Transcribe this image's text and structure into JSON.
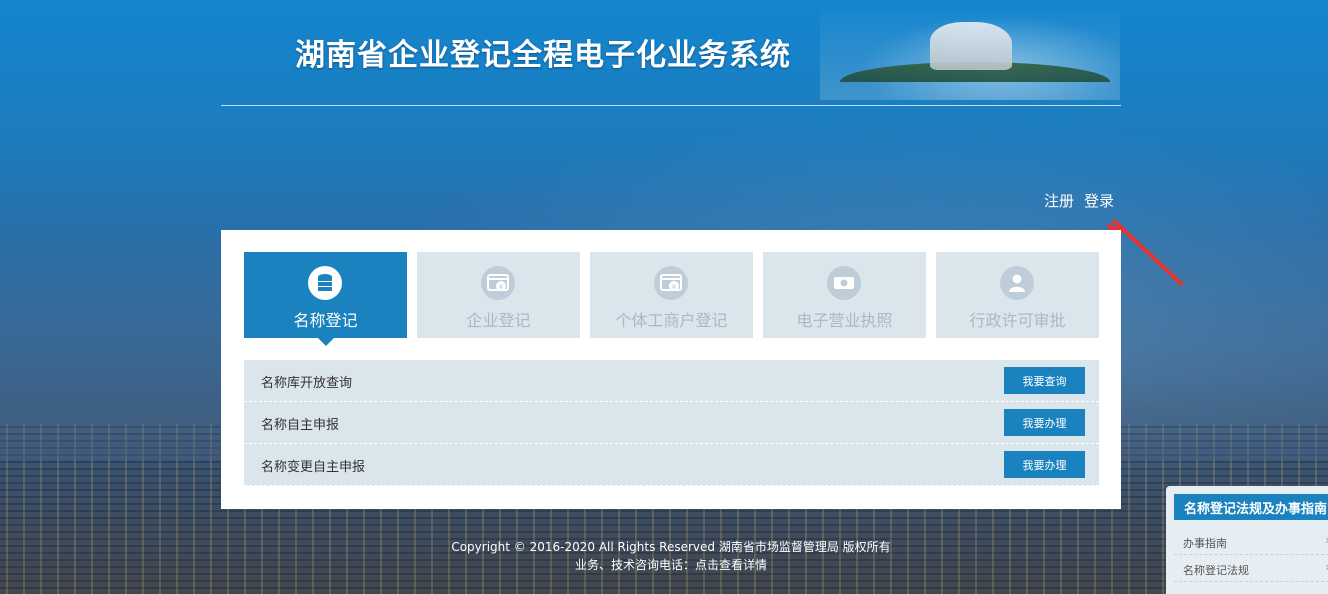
{
  "header": {
    "title": "湖南省企业登记全程电子化业务系统"
  },
  "auth": {
    "register": "注册",
    "login": "登录"
  },
  "tabs": [
    {
      "label": "名称登记",
      "icon": "database-icon",
      "active": true
    },
    {
      "label": "企业登记",
      "icon": "browser-yen-icon",
      "active": false
    },
    {
      "label": "个体工商户登记",
      "icon": "browser-yen-icon",
      "active": false
    },
    {
      "label": "电子营业执照",
      "icon": "license-card-icon",
      "active": false
    },
    {
      "label": "行政许可审批",
      "icon": "user-icon",
      "active": false
    }
  ],
  "rows": [
    {
      "label": "名称库开放查询",
      "button": "我要查询"
    },
    {
      "label": "名称自主申报",
      "button": "我要办理"
    },
    {
      "label": "名称变更自主申报",
      "button": "我要办理"
    }
  ],
  "footer": {
    "copyright": "Copyright © 2016-2020 All Rights Reserved 湖南省市场监督管理局 版权所有",
    "contact": "业务、技术咨询电话：点击查看详情"
  },
  "side": {
    "title": "名称登记法规及办事指南",
    "items": [
      "办事指南",
      "名称登记法规"
    ]
  },
  "colors": {
    "accent": "#1a82bf",
    "tab_inactive_bg": "#dbe5ec",
    "annotation_arrow": "#e8332c"
  }
}
